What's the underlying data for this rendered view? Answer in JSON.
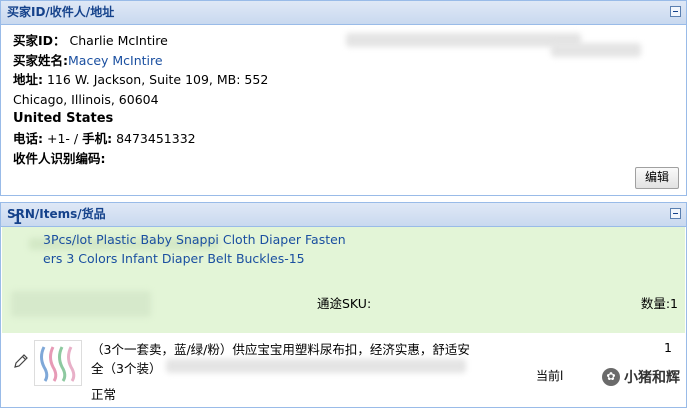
{
  "buyer_panel": {
    "title": "买家ID/收件人/地址",
    "buyer_id_label": "买家ID：",
    "buyer_id": "Charlie McIntire",
    "buyer_name_label": "买家姓名:",
    "buyer_name": "Macey McIntire",
    "address_label": "地址:",
    "address_line1": "116 W. Jackson,  Suite 109, MB: 552",
    "address_line2": "Chicago, Illinois, 60604",
    "country": "United States",
    "phone_label": "电话:",
    "phone": "+1- / ",
    "mobile_label": "手机:",
    "mobile": "8473451332",
    "recipient_id_label": "收件人识别编码:",
    "edit_button": "编辑"
  },
  "items_panel": {
    "title": "SRN/Items/货品",
    "item_index": "1",
    "item_title_line1": "3Pcs/lot Plastic Baby Snappi Cloth Diaper Fasten",
    "item_title_line2": "ers 3 Colors Infant Diaper Belt Buckles-15",
    "sku_label": "通途SKU:",
    "quantity_label": "数量:1",
    "desc_line1": "（3个一套卖，蓝/绿/粉）供应宝宝用塑料尿布扣，经济实惠，舒适安",
    "desc_line2": "全（3个装）",
    "quantity_value": "1",
    "current_label": "当前l",
    "status": "正常",
    "watermark_text": "小猪和辉"
  }
}
